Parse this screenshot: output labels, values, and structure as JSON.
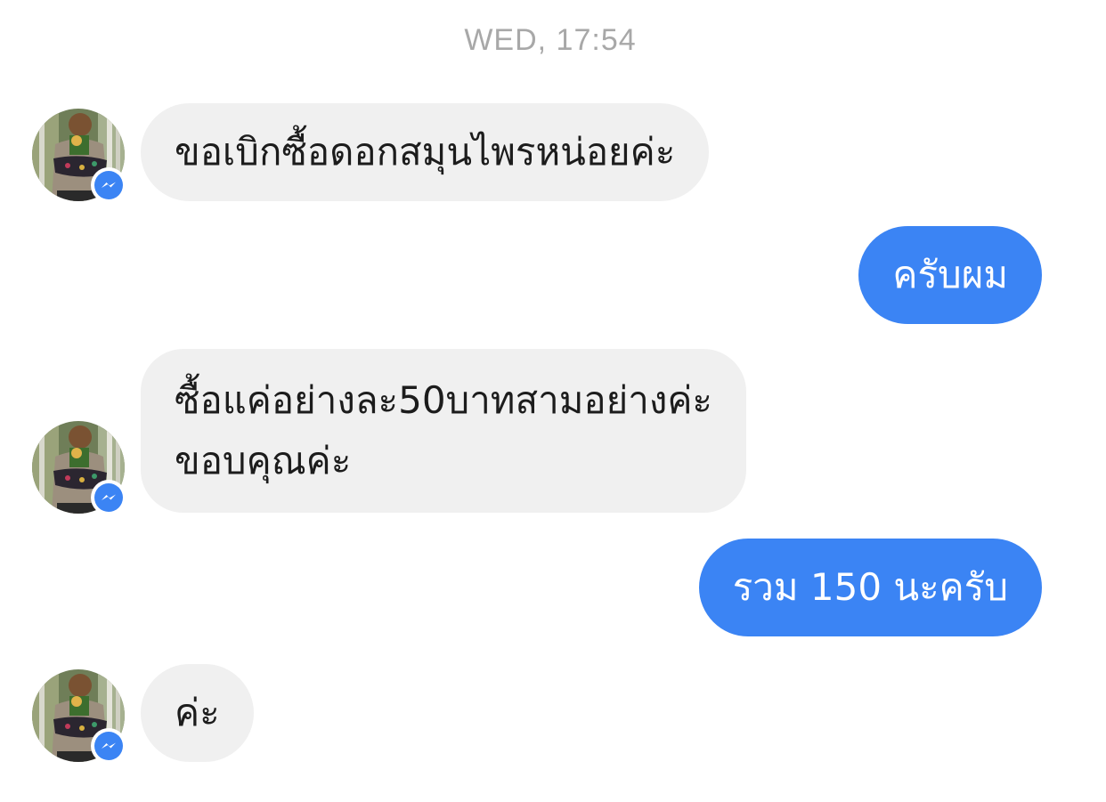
{
  "conversation": {
    "timestamp": "WED, 17:54",
    "colors": {
      "outgoing_bubble": "#3b84f4",
      "incoming_bubble": "#f0f0f0",
      "timestamp_text": "#a8a8a8",
      "messenger_badge": "#3b84f4"
    },
    "avatar_badge_icon": "messenger-icon",
    "messages": [
      {
        "direction": "incoming",
        "lines": [
          "ขอเบิกซื้อดอกสมุนไพรหน่อยค่ะ"
        ]
      },
      {
        "direction": "outgoing",
        "lines": [
          "ครับผม"
        ]
      },
      {
        "direction": "incoming",
        "lines": [
          "ซื้อแค่อย่างละ50บาทสามอย่างค่ะ",
          "ขอบคุณค่ะ"
        ]
      },
      {
        "direction": "outgoing",
        "lines": [
          "รวม 150 นะครับ"
        ]
      },
      {
        "direction": "incoming",
        "lines": [
          "ค่ะ"
        ]
      }
    ]
  }
}
